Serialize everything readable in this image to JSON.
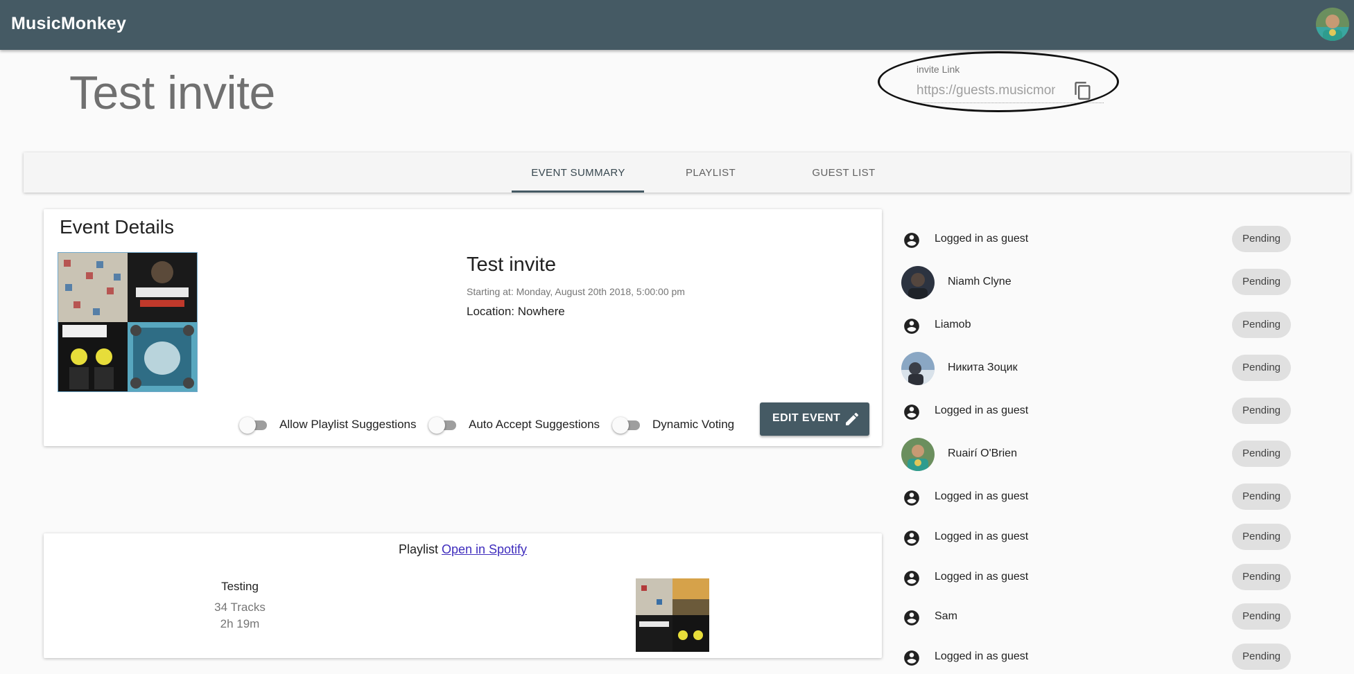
{
  "app": {
    "title": "MusicMonkey",
    "avatar_icon": "user-avatar"
  },
  "event": {
    "title": "Test invite",
    "invite_label": "invite Link",
    "invite_url": "https://guests.musicmonkey",
    "copy_icon": "copy-icon"
  },
  "tabs": [
    {
      "label": "EVENT SUMMARY",
      "active": true
    },
    {
      "label": "PLAYLIST",
      "active": false
    },
    {
      "label": "GUEST LIST",
      "active": false
    }
  ],
  "details": {
    "heading": "Event Details",
    "name": "Test invite",
    "starting": "Starting at: Monday, August 20th 2018, 5:00:00 pm",
    "location": "Location: Nowhere",
    "toggles": [
      {
        "label": "Allow Playlist Suggestions",
        "on": false
      },
      {
        "label": "Auto Accept Suggestions",
        "on": false
      },
      {
        "label": "Dynamic Voting",
        "on": false
      }
    ],
    "edit_button": "EDIT EVENT"
  },
  "playlist": {
    "prefix": "Playlist",
    "link": "Open in Spotify",
    "name": "Testing",
    "tracks": "34 Tracks",
    "duration": "2h 19m"
  },
  "guests": [
    {
      "name": "Logged in as guest",
      "avatar": "person-icon",
      "status": "Pending"
    },
    {
      "name": "Niamh Clyne",
      "avatar": "photo",
      "status": "Pending"
    },
    {
      "name": "Liamob",
      "avatar": "person-icon",
      "status": "Pending"
    },
    {
      "name": "Никита Зоцик",
      "avatar": "photo",
      "status": "Pending"
    },
    {
      "name": "Logged in as guest",
      "avatar": "person-icon",
      "status": "Pending"
    },
    {
      "name": "Ruairí O'Brien",
      "avatar": "photo",
      "status": "Pending"
    },
    {
      "name": "Logged in as guest",
      "avatar": "person-icon",
      "status": "Pending"
    },
    {
      "name": "Logged in as guest",
      "avatar": "person-icon",
      "status": "Pending"
    },
    {
      "name": "Logged in as guest",
      "avatar": "person-icon",
      "status": "Pending"
    },
    {
      "name": "Sam",
      "avatar": "person-icon",
      "status": "Pending"
    },
    {
      "name": "Logged in as guest",
      "avatar": "person-icon",
      "status": "Pending"
    }
  ],
  "colors": {
    "appbar": "#455a64",
    "chip": "#e0e0e0",
    "link": "#3f2dbd"
  }
}
